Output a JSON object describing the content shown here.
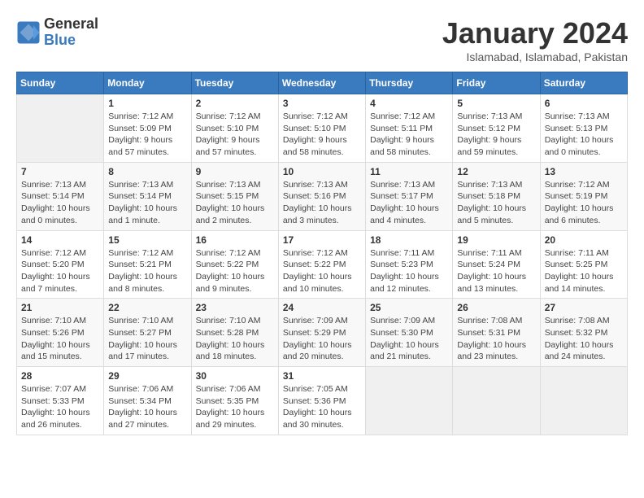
{
  "header": {
    "logo_general": "General",
    "logo_blue": "Blue",
    "month_title": "January 2024",
    "location": "Islamabad, Islamabad, Pakistan"
  },
  "weekdays": [
    "Sunday",
    "Monday",
    "Tuesday",
    "Wednesday",
    "Thursday",
    "Friday",
    "Saturday"
  ],
  "weeks": [
    [
      {
        "day": "",
        "info": ""
      },
      {
        "day": "1",
        "info": "Sunrise: 7:12 AM\nSunset: 5:09 PM\nDaylight: 9 hours\nand 57 minutes."
      },
      {
        "day": "2",
        "info": "Sunrise: 7:12 AM\nSunset: 5:10 PM\nDaylight: 9 hours\nand 57 minutes."
      },
      {
        "day": "3",
        "info": "Sunrise: 7:12 AM\nSunset: 5:10 PM\nDaylight: 9 hours\nand 58 minutes."
      },
      {
        "day": "4",
        "info": "Sunrise: 7:12 AM\nSunset: 5:11 PM\nDaylight: 9 hours\nand 58 minutes."
      },
      {
        "day": "5",
        "info": "Sunrise: 7:13 AM\nSunset: 5:12 PM\nDaylight: 9 hours\nand 59 minutes."
      },
      {
        "day": "6",
        "info": "Sunrise: 7:13 AM\nSunset: 5:13 PM\nDaylight: 10 hours\nand 0 minutes."
      }
    ],
    [
      {
        "day": "7",
        "info": "Sunrise: 7:13 AM\nSunset: 5:14 PM\nDaylight: 10 hours\nand 0 minutes."
      },
      {
        "day": "8",
        "info": "Sunrise: 7:13 AM\nSunset: 5:14 PM\nDaylight: 10 hours\nand 1 minute."
      },
      {
        "day": "9",
        "info": "Sunrise: 7:13 AM\nSunset: 5:15 PM\nDaylight: 10 hours\nand 2 minutes."
      },
      {
        "day": "10",
        "info": "Sunrise: 7:13 AM\nSunset: 5:16 PM\nDaylight: 10 hours\nand 3 minutes."
      },
      {
        "day": "11",
        "info": "Sunrise: 7:13 AM\nSunset: 5:17 PM\nDaylight: 10 hours\nand 4 minutes."
      },
      {
        "day": "12",
        "info": "Sunrise: 7:13 AM\nSunset: 5:18 PM\nDaylight: 10 hours\nand 5 minutes."
      },
      {
        "day": "13",
        "info": "Sunrise: 7:12 AM\nSunset: 5:19 PM\nDaylight: 10 hours\nand 6 minutes."
      }
    ],
    [
      {
        "day": "14",
        "info": "Sunrise: 7:12 AM\nSunset: 5:20 PM\nDaylight: 10 hours\nand 7 minutes."
      },
      {
        "day": "15",
        "info": "Sunrise: 7:12 AM\nSunset: 5:21 PM\nDaylight: 10 hours\nand 8 minutes."
      },
      {
        "day": "16",
        "info": "Sunrise: 7:12 AM\nSunset: 5:22 PM\nDaylight: 10 hours\nand 9 minutes."
      },
      {
        "day": "17",
        "info": "Sunrise: 7:12 AM\nSunset: 5:22 PM\nDaylight: 10 hours\nand 10 minutes."
      },
      {
        "day": "18",
        "info": "Sunrise: 7:11 AM\nSunset: 5:23 PM\nDaylight: 10 hours\nand 12 minutes."
      },
      {
        "day": "19",
        "info": "Sunrise: 7:11 AM\nSunset: 5:24 PM\nDaylight: 10 hours\nand 13 minutes."
      },
      {
        "day": "20",
        "info": "Sunrise: 7:11 AM\nSunset: 5:25 PM\nDaylight: 10 hours\nand 14 minutes."
      }
    ],
    [
      {
        "day": "21",
        "info": "Sunrise: 7:10 AM\nSunset: 5:26 PM\nDaylight: 10 hours\nand 15 minutes."
      },
      {
        "day": "22",
        "info": "Sunrise: 7:10 AM\nSunset: 5:27 PM\nDaylight: 10 hours\nand 17 minutes."
      },
      {
        "day": "23",
        "info": "Sunrise: 7:10 AM\nSunset: 5:28 PM\nDaylight: 10 hours\nand 18 minutes."
      },
      {
        "day": "24",
        "info": "Sunrise: 7:09 AM\nSunset: 5:29 PM\nDaylight: 10 hours\nand 20 minutes."
      },
      {
        "day": "25",
        "info": "Sunrise: 7:09 AM\nSunset: 5:30 PM\nDaylight: 10 hours\nand 21 minutes."
      },
      {
        "day": "26",
        "info": "Sunrise: 7:08 AM\nSunset: 5:31 PM\nDaylight: 10 hours\nand 23 minutes."
      },
      {
        "day": "27",
        "info": "Sunrise: 7:08 AM\nSunset: 5:32 PM\nDaylight: 10 hours\nand 24 minutes."
      }
    ],
    [
      {
        "day": "28",
        "info": "Sunrise: 7:07 AM\nSunset: 5:33 PM\nDaylight: 10 hours\nand 26 minutes."
      },
      {
        "day": "29",
        "info": "Sunrise: 7:06 AM\nSunset: 5:34 PM\nDaylight: 10 hours\nand 27 minutes."
      },
      {
        "day": "30",
        "info": "Sunrise: 7:06 AM\nSunset: 5:35 PM\nDaylight: 10 hours\nand 29 minutes."
      },
      {
        "day": "31",
        "info": "Sunrise: 7:05 AM\nSunset: 5:36 PM\nDaylight: 10 hours\nand 30 minutes."
      },
      {
        "day": "",
        "info": ""
      },
      {
        "day": "",
        "info": ""
      },
      {
        "day": "",
        "info": ""
      }
    ]
  ]
}
